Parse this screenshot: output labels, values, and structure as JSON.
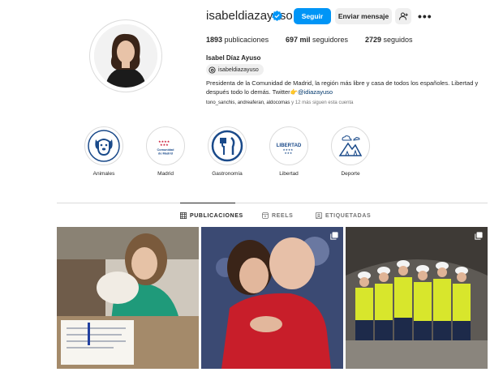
{
  "profile": {
    "username": "isabeldiazayuso",
    "full_name": "Isabel Díaz Ayuso",
    "threads_handle": "isabeldiazayuso",
    "bio_text": "Presidenta de la Comunidad de Madrid, la región más libre y casa de todos los españoles. Libertad y después todo lo demás. Twitter👉",
    "bio_link": "@idiazayuso",
    "followed_by_names": "tono_sanchis, andreaferan, aldocomas",
    "followed_by_more": " y 12 más siguen esta cuenta"
  },
  "actions": {
    "follow": "Seguir",
    "message": "Enviar mensaje",
    "suggest_icon": "add-person-icon",
    "more_icon": "more-options-icon",
    "more_glyph": "•••"
  },
  "stats": {
    "posts_count": "1893",
    "posts_label": " publicaciones",
    "followers_count": "697 mil",
    "followers_label": " seguidores",
    "following_count": "2729",
    "following_label": " seguidos"
  },
  "highlights": [
    {
      "label": "Animales",
      "icon": "dog-icon"
    },
    {
      "label": "Madrid",
      "icon": "madrid-logo-icon",
      "icon_text": "Comunidad de Madrid"
    },
    {
      "label": "Gastronomía",
      "icon": "cutlery-icon"
    },
    {
      "label": "Libertad",
      "icon": "libertad-logo-icon",
      "icon_text": "LIBERTAD"
    },
    {
      "label": "Deporte",
      "icon": "mountain-icon"
    }
  ],
  "tabs": [
    {
      "label": "PUBLICACIONES",
      "icon": "grid-icon",
      "active": true
    },
    {
      "label": "REELS",
      "icon": "reels-icon",
      "active": false
    },
    {
      "label": "ETIQUETADAS",
      "icon": "tagged-icon",
      "active": false
    }
  ],
  "colors": {
    "accent": "#0095f6",
    "verified": "#0095f6",
    "highlight_blue": "#1a4a8a"
  }
}
